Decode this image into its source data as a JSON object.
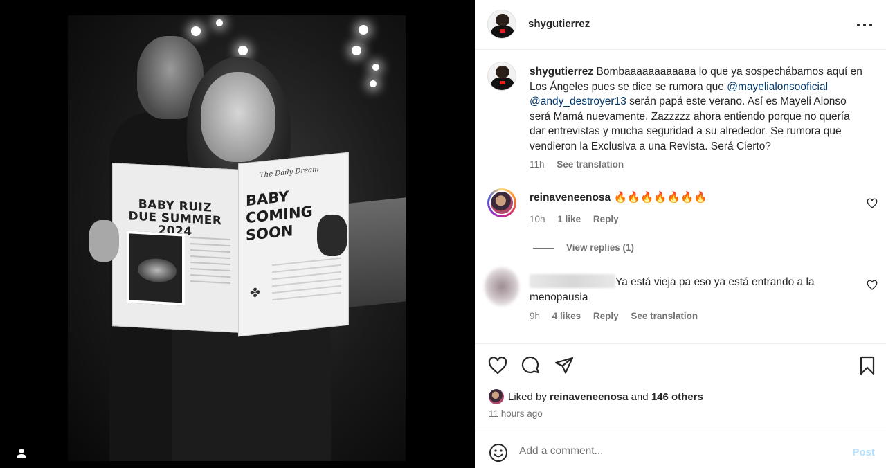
{
  "post": {
    "author": "shygutierrez",
    "image": {
      "newspaper_left_headline": "BABY RUIZ DUE SUMMER 2024",
      "newspaper_right_headline": "BABY COMING SOON",
      "newspaper_masthead": "The Daily Dream"
    }
  },
  "caption": {
    "username": "shygutierrez",
    "text_before_mentions": "Bombaaaaaaaaaaaa lo que ya sospechábamos aquí en Los Ángeles pues se dice se rumora que ",
    "mention_1": "@mayelialonsooficial",
    "mention_2": "@andy_destroyer13",
    "text_after_mentions": " serán papá este verano. Así es Mayeli Alonso será Mamá nuevamente. Zazzzzz ahora entiendo porque no quería dar entrevistas y mucha seguridad a su alrededor. Se rumora que vendieron la Exclusiva a una Revista. Será Cierto?",
    "time": "11h",
    "see_translation": "See translation"
  },
  "comments": [
    {
      "username": "reinaveneenosa",
      "text": "🔥🔥🔥🔥🔥🔥🔥",
      "time": "10h",
      "likes": "1 like",
      "reply": "Reply",
      "view_replies": "View replies (1)"
    },
    {
      "text": "Ya está vieja pa eso ya está entrando a la menopausia",
      "time": "9h",
      "likes": "4 likes",
      "reply": "Reply",
      "see_translation": "See translation"
    }
  ],
  "likes_summary": {
    "prefix": "Liked by ",
    "user": "reinaveneenosa",
    "middle": " and ",
    "others": "146 others"
  },
  "time_ago": "11 hours ago",
  "add_comment": {
    "placeholder": "Add a comment...",
    "post_label": "Post"
  },
  "icons": {
    "more": "more-options-icon",
    "like": "heart-icon",
    "comment": "comment-icon",
    "share": "share-icon",
    "save": "bookmark-icon",
    "emoji": "emoji-icon",
    "profile": "profile-icon"
  },
  "colors": {
    "link": "#00376b",
    "secondary_text": "#737373",
    "post_button_disabled": "#b2dffc"
  }
}
